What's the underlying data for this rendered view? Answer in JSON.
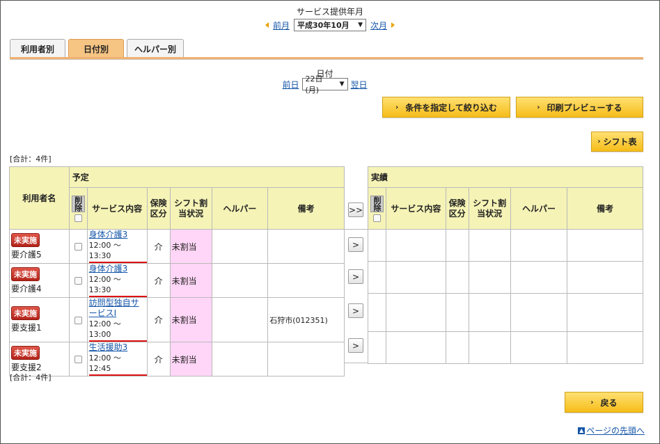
{
  "header": {
    "month_title": "サービス提供年月",
    "prev_month": "前月",
    "next_month": "次月",
    "month_select": "平成30年10月"
  },
  "tabs": [
    {
      "label": "利用者別",
      "active": false
    },
    {
      "label": "日付別",
      "active": true
    },
    {
      "label": "ヘルパー別",
      "active": false
    }
  ],
  "date": {
    "title": "日付",
    "prev_day": "前日",
    "next_day": "翌日",
    "day_select": "22日(月)"
  },
  "buttons": {
    "filter": "条件を指定して絞り込む",
    "print_preview": "印刷プレビューする",
    "shift_table": "シフト表",
    "back": "戻る"
  },
  "total": "[合計：4件]",
  "table": {
    "user_name_header": "利用者名",
    "plan_header": "予定",
    "actual_header": "実績",
    "columns": {
      "delete": "削除",
      "service": "サービス内容",
      "insurance": "保険区分",
      "shift": "シフト割当状況",
      "helper": "ヘルパー",
      "note": "備考"
    },
    "copy_all": ">>",
    "copy_one": ">",
    "rows": [
      {
        "status": "未実施",
        "level": "要介護5",
        "service": "身体介護3",
        "time": "12:00 〜　13:30",
        "insurance": "介",
        "shift": "未割当",
        "helper": "",
        "note": ""
      },
      {
        "status": "未実施",
        "level": "要介護4",
        "service": "身体介護3",
        "time": "12:00 〜　13:30",
        "insurance": "介",
        "shift": "未割当",
        "helper": "",
        "note": ""
      },
      {
        "status": "未実施",
        "level": "要支援1",
        "service": "訪問型独自サービスⅠ",
        "time": "12:00 〜　13:00",
        "insurance": "介",
        "shift": "未割当",
        "helper": "",
        "note": "石狩市(012351)"
      },
      {
        "status": "未実施",
        "level": "要支援2",
        "service": "生活援助3",
        "time": "12:00 〜　12:45",
        "insurance": "介",
        "shift": "未割当",
        "helper": "",
        "note": ""
      }
    ]
  },
  "footer": {
    "page_top": "ページの先頭へ"
  }
}
